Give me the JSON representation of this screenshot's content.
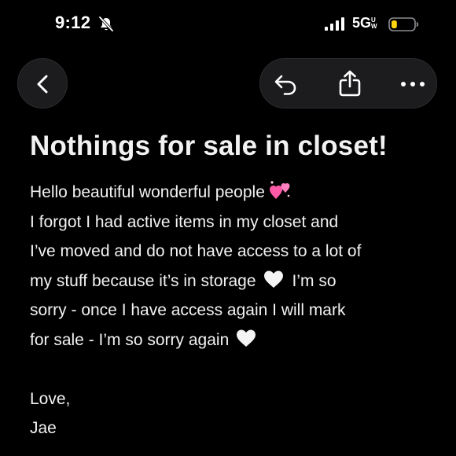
{
  "status_bar": {
    "time": "9:12",
    "network": "5G",
    "network_suffix": "UW",
    "battery_level": 0.25,
    "battery_color": "#ffd60a"
  },
  "nav": {
    "back_icon": "chevron-left-icon",
    "reply_icon": "reply-arrow-icon",
    "share_icon": "share-icon",
    "more_icon": "ellipsis-icon"
  },
  "post": {
    "title": "Nothings for sale in closet!",
    "lines": [
      "Hello beautiful wonderful people",
      "I forgot I had active items in my closet and",
      "I’ve moved and do not have access to a lot of",
      "my stuff because it’s in storage",
      "I’m so",
      "sorry - once I have access again I will mark",
      "for sale - I’m so sorry again"
    ],
    "signoff": "Love,",
    "signature": "Jae",
    "emoji_names": [
      "two-hearts-emoji",
      "white-heart-emoji",
      "white-heart-emoji"
    ]
  },
  "colors": {
    "background": "#000000",
    "text": "#f2f2f2",
    "button_bg": "#1c1c1e",
    "heart_pink": "#ff4fa3"
  }
}
